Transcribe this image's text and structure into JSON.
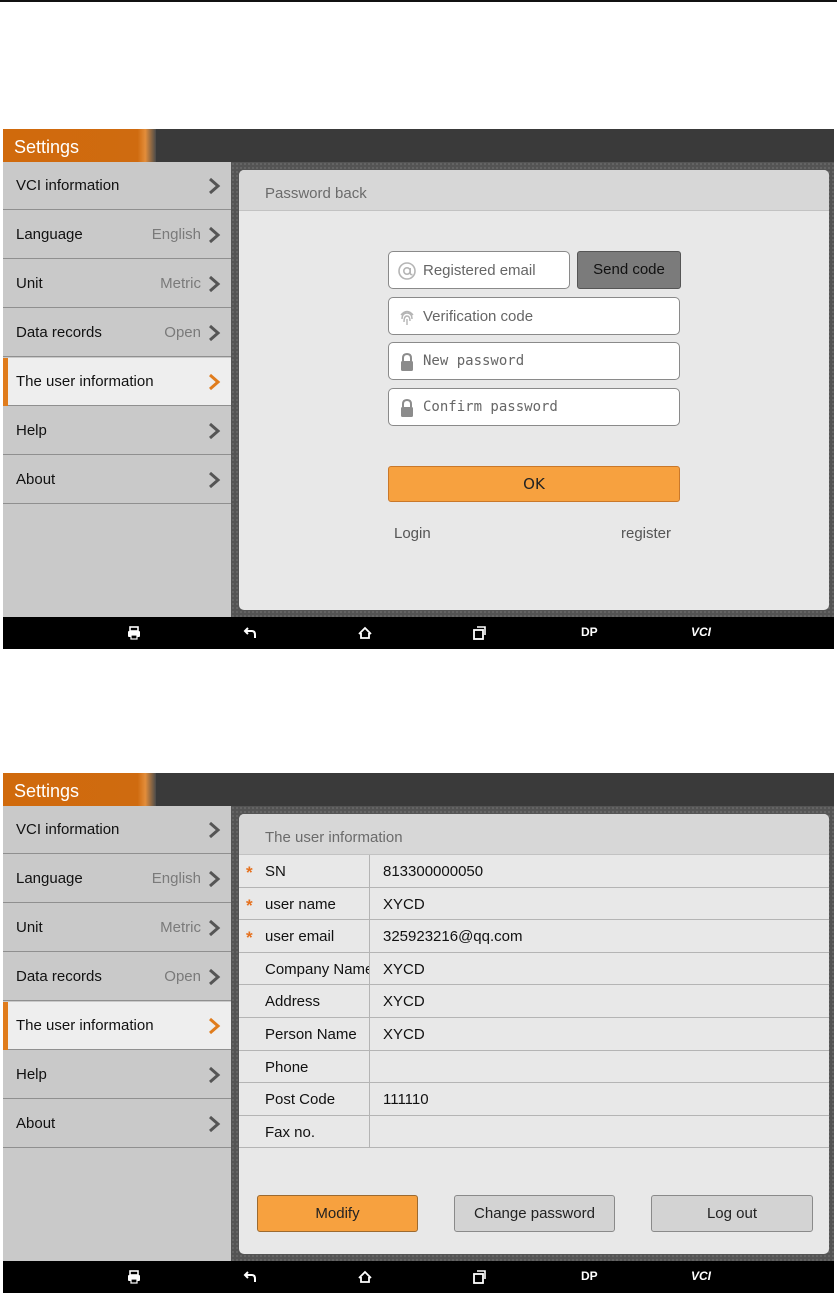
{
  "app": {
    "title": "Settings"
  },
  "sidebar": {
    "items": [
      {
        "label": "VCI information",
        "value": ""
      },
      {
        "label": "Language",
        "value": "English"
      },
      {
        "label": "Unit",
        "value": "Metric"
      },
      {
        "label": "Data records",
        "value": "Open"
      },
      {
        "label": "The user information",
        "value": ""
      },
      {
        "label": "Help",
        "value": ""
      },
      {
        "label": "About",
        "value": ""
      }
    ],
    "active_index": 4
  },
  "password_back": {
    "title": "Password back",
    "email_placeholder": "Registered email",
    "send_code_label": "Send code",
    "verification_placeholder": "Verification code",
    "new_password_placeholder": "New password",
    "confirm_password_placeholder": "Confirm password",
    "ok_label": "OK",
    "login_label": "Login",
    "register_label": "register"
  },
  "user_info": {
    "title": "The user information",
    "rows": [
      {
        "label": "SN",
        "value": "813300000050",
        "required": true
      },
      {
        "label": "user name",
        "value": "XYCD",
        "required": true
      },
      {
        "label": "user email",
        "value": "325923216@qq.com",
        "required": true
      },
      {
        "label": "Company Name",
        "value": "XYCD",
        "required": false
      },
      {
        "label": "Address",
        "value": "XYCD",
        "required": false
      },
      {
        "label": "Person Name",
        "value": "XYCD",
        "required": false
      },
      {
        "label": "Phone",
        "value": "",
        "required": false
      },
      {
        "label": "Post Code",
        "value": "111110",
        "required": false
      },
      {
        "label": "Fax no.",
        "value": "",
        "required": false
      }
    ],
    "required_mark": "*",
    "modify_label": "Modify",
    "change_password_label": "Change password",
    "logout_label": "Log out"
  },
  "navbar": {
    "icons": [
      "printer-icon",
      "back-icon",
      "home-icon",
      "recent-apps-icon",
      "dp-icon",
      "vci-icon"
    ],
    "dp_label": "DP",
    "vci_label": "VCI"
  },
  "colors": {
    "accent": "#e07c1c",
    "button_orange": "#f7a13f",
    "title_bar": "#cf6b10"
  }
}
